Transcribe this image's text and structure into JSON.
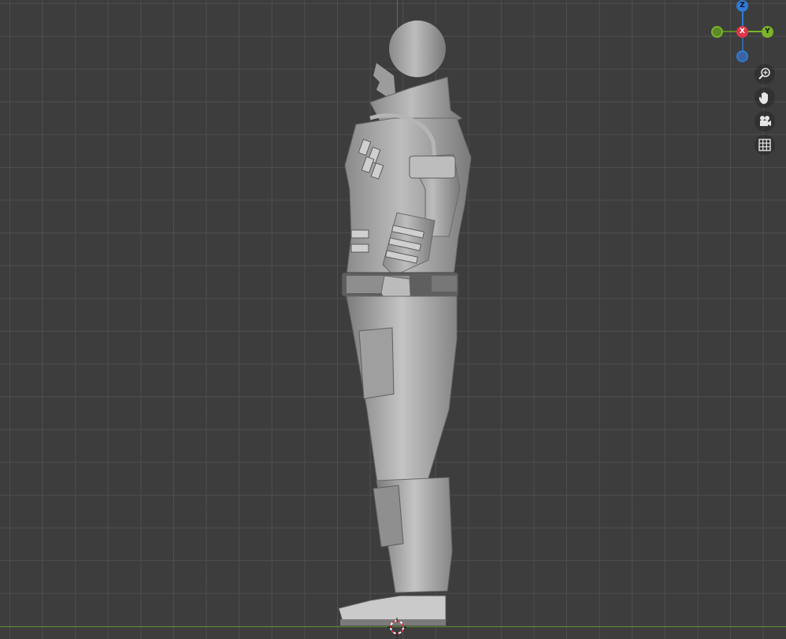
{
  "viewport": {
    "background_color": "#3d3d3d",
    "grid_color": "#505050",
    "horizon_axis_color": "#5e8b2a",
    "vertical_axis_color": "#2f6fbf",
    "model_color": "#a8a8a8",
    "object": "character-sculpt-side-view"
  },
  "gizmo": {
    "z_label": "Z",
    "x_label": "X",
    "y_label": "Y",
    "z_color": "#2f7ad6",
    "x_color": "#e0354b",
    "y_color": "#7bb52a",
    "neg_color_z": "#3a63a0",
    "neg_color_y": "#5c8a26"
  },
  "navigation": {
    "buttons": [
      {
        "name": "zoom-icon",
        "tooltip": ""
      },
      {
        "name": "pan-hand-icon",
        "tooltip": ""
      },
      {
        "name": "camera-icon",
        "tooltip": ""
      },
      {
        "name": "grid-icon",
        "tooltip": ""
      }
    ]
  },
  "cursor_3d": {
    "colors": [
      "#ffffff",
      "#e0354b"
    ]
  }
}
